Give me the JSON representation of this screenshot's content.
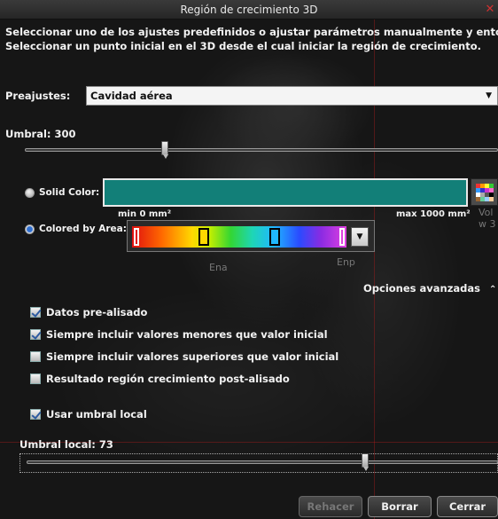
{
  "window": {
    "title": "Región de crecimiento 3D",
    "close_glyph": "✕"
  },
  "description": {
    "line1": "Seleccionar uno de los ajustes predefinidos o ajustar parámetros manualmente y entonces",
    "line2": "Seleccionar un punto inicial en el 3D desde el cual iniciar la región de crecimiento."
  },
  "presets": {
    "label": "Preajustes:",
    "selected": "Cavidad aérea"
  },
  "threshold": {
    "label": "Umbral: 300",
    "value": 300
  },
  "color": {
    "solid_label": "Solid Color:",
    "solid_value": "#127f78",
    "area_label": "Colored by Area:",
    "area_selected": true,
    "min_label": "min 0 mm²",
    "max_label": "max 1000 mm²",
    "palette_icon": "color-palette-icon"
  },
  "background_hints": {
    "ena": "Ena",
    "enp": "Enp",
    "vol1": "Vol",
    "vol2": "w 3"
  },
  "advanced": {
    "label": "Opciones avanzadas",
    "expanded": true
  },
  "options": [
    {
      "label": "Datos pre-alisado",
      "checked": true
    },
    {
      "label": "Siempre incluir valores menores que valor inicial",
      "checked": true
    },
    {
      "label": "Siempre incluir valores superiores que valor inicial",
      "checked": false
    },
    {
      "label": "Resultado región crecimiento post-alisado",
      "checked": false
    }
  ],
  "local_threshold": {
    "checkbox_label": "Usar umbral local",
    "checked": true,
    "label": "Umbral local: 73",
    "value": 73
  },
  "buttons": {
    "redo": "Rehacer",
    "clear": "Borrar",
    "close": "Cerrar"
  }
}
